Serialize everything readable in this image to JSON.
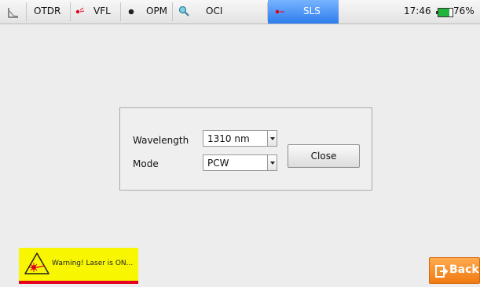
{
  "tabs": [
    {
      "label": "OTDR",
      "icon": "otdr-trace-icon"
    },
    {
      "label": "VFL",
      "icon": "vfl-laser-icon"
    },
    {
      "label": "OPM",
      "icon": "opm-dot-icon"
    },
    {
      "label": "OCI",
      "icon": "oci-magnifier-icon"
    },
    {
      "label": "SLS",
      "icon": "sls-laser-icon",
      "active": true
    }
  ],
  "status": {
    "time": "17:46",
    "battery_percent": "76%",
    "battery_level": 0.76
  },
  "dialog": {
    "wavelength_label": "Wavelength",
    "wavelength_value": "1310 nm",
    "mode_label": "Mode",
    "mode_value": "PCW",
    "close_label": "Close"
  },
  "warning": {
    "text": "Warning! Laser is ON..."
  },
  "back": {
    "label": "Back"
  },
  "colors": {
    "active_tab": "#2d7ded",
    "warning_bg": "#f8f600",
    "warning_bar": "#e3001c",
    "back_button": "#f58a20",
    "battery": "#21b43b"
  }
}
